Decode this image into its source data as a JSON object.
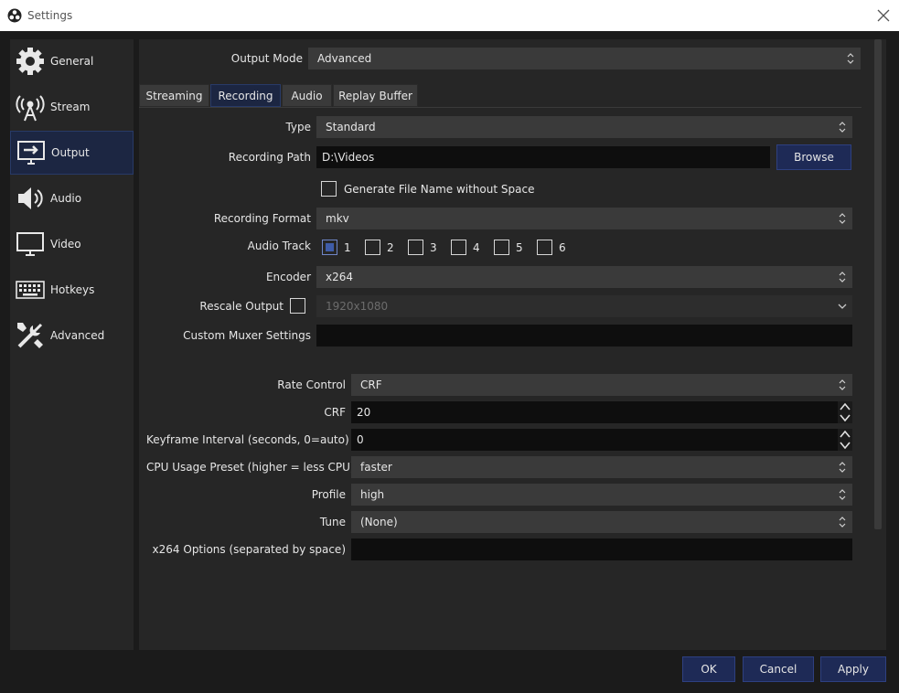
{
  "window": {
    "title": "Settings"
  },
  "sidebar": {
    "items": [
      {
        "label": "General",
        "icon": "gear-icon"
      },
      {
        "label": "Stream",
        "icon": "broadcast-tower-icon"
      },
      {
        "label": "Output",
        "icon": "output-monitor-icon",
        "active": true
      },
      {
        "label": "Audio",
        "icon": "speaker-icon"
      },
      {
        "label": "Video",
        "icon": "monitor-icon"
      },
      {
        "label": "Hotkeys",
        "icon": "keyboard-icon"
      },
      {
        "label": "Advanced",
        "icon": "tools-icon"
      }
    ]
  },
  "output_mode": {
    "label": "Output Mode",
    "value": "Advanced"
  },
  "tabs": [
    {
      "label": "Streaming"
    },
    {
      "label": "Recording",
      "active": true
    },
    {
      "label": "Audio"
    },
    {
      "label": "Replay Buffer"
    }
  ],
  "recording": {
    "type": {
      "label": "Type",
      "value": "Standard"
    },
    "path": {
      "label": "Recording Path",
      "value": "D:\\Videos",
      "browse": "Browse"
    },
    "no_space": {
      "label": "Generate File Name without Space",
      "checked": false
    },
    "format": {
      "label": "Recording Format",
      "value": "mkv"
    },
    "audio_track": {
      "label": "Audio Track",
      "tracks": [
        {
          "label": "1",
          "checked": true
        },
        {
          "label": "2",
          "checked": false
        },
        {
          "label": "3",
          "checked": false
        },
        {
          "label": "4",
          "checked": false
        },
        {
          "label": "5",
          "checked": false
        },
        {
          "label": "6",
          "checked": false
        }
      ]
    },
    "encoder": {
      "label": "Encoder",
      "value": "x264"
    },
    "rescale": {
      "label": "Rescale Output",
      "checked": false,
      "value": "1920x1080"
    },
    "muxer": {
      "label": "Custom Muxer Settings",
      "value": ""
    }
  },
  "encoder_settings": {
    "rate_control": {
      "label": "Rate Control",
      "value": "CRF"
    },
    "crf": {
      "label": "CRF",
      "value": "20"
    },
    "keyframe": {
      "label": "Keyframe Interval (seconds, 0=auto)",
      "value": "0"
    },
    "cpu_preset": {
      "label": "CPU Usage Preset (higher = less CPU)",
      "value": "faster"
    },
    "profile": {
      "label": "Profile",
      "value": "high"
    },
    "tune": {
      "label": "Tune",
      "value": "(None)"
    },
    "x264_options": {
      "label": "x264 Options (separated by space)",
      "value": ""
    }
  },
  "footer": {
    "ok": "OK",
    "cancel": "Cancel",
    "apply": "Apply"
  },
  "colors": {
    "accent": "#1e2a56",
    "active_bg": "#1c2642",
    "panel_bg": "#262626",
    "window_bg": "#1b1b1b"
  }
}
